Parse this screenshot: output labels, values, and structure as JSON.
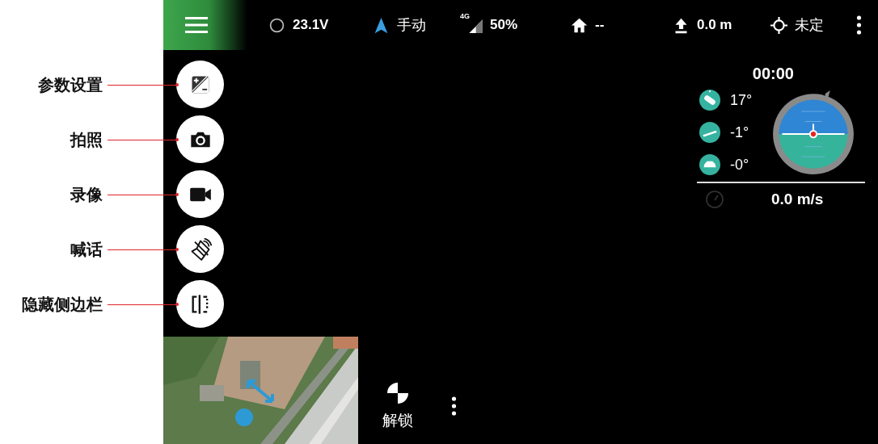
{
  "annotations": [
    {
      "label": "参数设置"
    },
    {
      "label": "拍照"
    },
    {
      "label": "录像"
    },
    {
      "label": "喊话"
    },
    {
      "label": "隐藏侧边栏"
    }
  ],
  "status_bar": [
    {
      "kind": "battery",
      "text": "23.1V"
    },
    {
      "kind": "mode",
      "text": "手动"
    },
    {
      "kind": "signal",
      "badge": "4G",
      "text": "50%"
    },
    {
      "kind": "home",
      "text": "--"
    },
    {
      "kind": "altitude",
      "text": "0.0 m"
    },
    {
      "kind": "gps",
      "text": "未定"
    }
  ],
  "side_buttons": [
    {
      "kind": "exposure"
    },
    {
      "kind": "camera"
    },
    {
      "kind": "video"
    },
    {
      "kind": "speaker"
    },
    {
      "kind": "sidebar"
    }
  ],
  "flight": {
    "timer": "00:00",
    "angles": [
      {
        "kind": "roll",
        "text": "17°"
      },
      {
        "kind": "pitch",
        "text": "-1°"
      },
      {
        "kind": "yaw",
        "text": "-0°"
      }
    ],
    "speed": "0.0 m/s"
  },
  "unlock": {
    "label": "解锁"
  }
}
